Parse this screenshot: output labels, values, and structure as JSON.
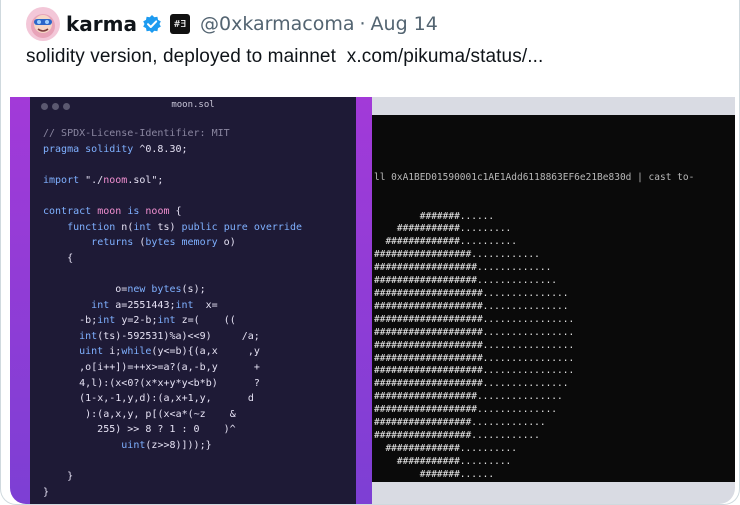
{
  "post": {
    "display_name": "karma",
    "handle": "@0xkarmacoma",
    "separator": "·",
    "date": "Aug 14",
    "affiliation_badge": "#Ǝ",
    "text": "solidity version, deployed to mainnet  ",
    "link": "x.com/pikuma/status/..."
  },
  "colors": {
    "verified": "#1d9bf0",
    "frame_purple": "#a23ad8",
    "code_bg": "#1e1a36",
    "terminal_bg": "#0a0a0a"
  },
  "code_window": {
    "title": "moon.sol",
    "lines": [
      "// SPDX-License-Identifier: MIT",
      "pragma solidity ^0.8.30;",
      "",
      "import \"./noom.sol\";",
      "",
      "contract moon is noom {",
      "    function n(int ts) public pure override",
      "        returns (bytes memory o)",
      "    {",
      "",
      "            o=new bytes(s);",
      "        int a=2551443;int  x=",
      "      -b;int y=2-b;int z=(    ((",
      "      int(ts)-592531)%a)<<9)     /a;",
      "      uint i;while(y<=b){(a,x     ,y",
      "      ,o[i++])=++x>=a?(a,-b,y      +",
      "      4,l):(x<0?(x*x+y*y<b*b)      ?",
      "      (1-x,-1,y,d):(a,x+1,y,      d",
      "       ):(a,x,y, p[(x<a*(~z    &",
      "         255) >> 8 ? 1 : 0    )^",
      "             uint(z>>8)]));}",
      "",
      "    }",
      "}"
    ]
  },
  "terminal": {
    "command": "ll 0xA1BED01590001c1AE1Add6118863EF6e21Be830d | cast to-",
    "lines": [
      "        #######......",
      "    ###########.........",
      "  #############..........",
      "#################............",
      "##################.............",
      "##################..............",
      "###################...............",
      "###################...............",
      "###################................",
      "###################................",
      "###################................",
      "###################................",
      "###################................",
      "###################...............",
      "##################...............",
      "##################..............",
      "#################.............",
      "#################............",
      "  #############..........",
      "    ###########.........",
      "        #######......"
    ]
  }
}
